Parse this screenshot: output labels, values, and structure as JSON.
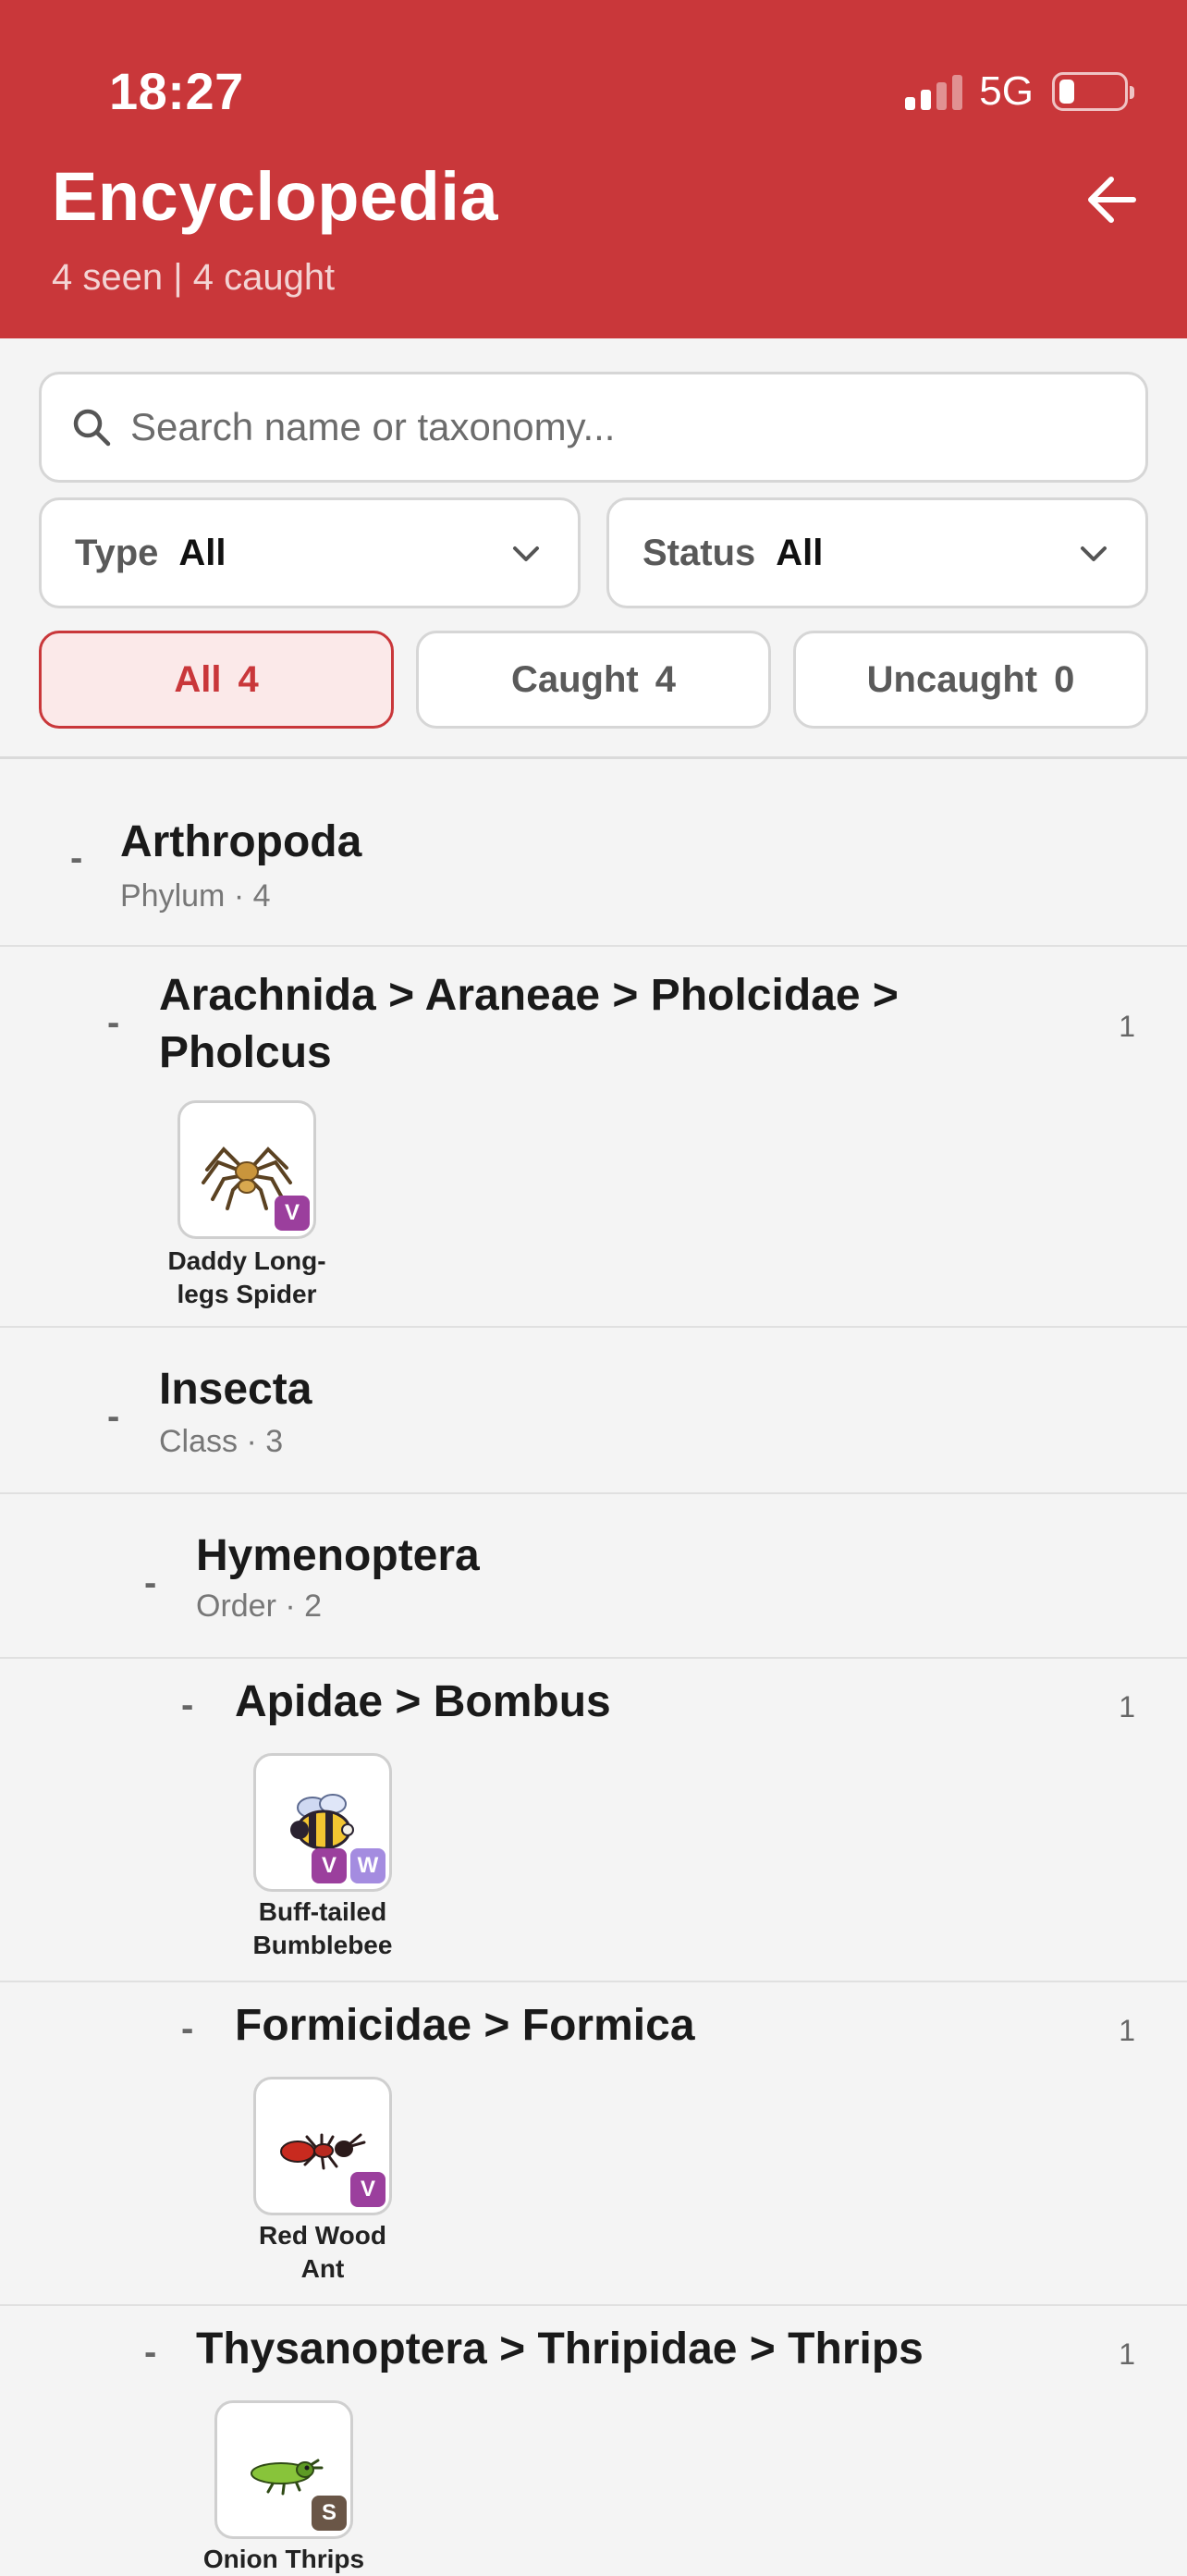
{
  "status_bar": {
    "time": "18:27",
    "network": "5G"
  },
  "header": {
    "title": "Encyclopedia",
    "subtitle": "4 seen | 4 caught"
  },
  "search": {
    "placeholder": "Search name or taxonomy..."
  },
  "filters": {
    "type": {
      "label": "Type",
      "value": "All"
    },
    "status": {
      "label": "Status",
      "value": "All"
    }
  },
  "chips": [
    {
      "label": "All",
      "count": "4"
    },
    {
      "label": "Caught",
      "count": "4"
    },
    {
      "label": "Uncaught",
      "count": "0"
    }
  ],
  "tree": {
    "collapse_symbol": "-",
    "arthropoda": {
      "title": "Arthropoda",
      "sub": "Phylum · 4"
    },
    "pholcus": {
      "title_line1": "Arachnida > Araneae > Pholcidae >",
      "title_line2": "Pholcus",
      "count": "1"
    },
    "insecta": {
      "title": "Insecta",
      "sub": "Class · 3"
    },
    "hymenoptera": {
      "title": "Hymenoptera",
      "sub": "Order · 2"
    },
    "bombus": {
      "title": "Apidae > Bombus",
      "count": "1"
    },
    "formica": {
      "title": "Formicidae > Formica",
      "count": "1"
    },
    "thrips": {
      "title": "Thysanoptera > Thripidae > Thrips",
      "count": "1"
    }
  },
  "species": {
    "spider": {
      "line1": "Daddy Long-",
      "line2": "legs Spider",
      "badges": [
        "V"
      ],
      "icon": "spider-icon"
    },
    "bee": {
      "line1": "Buff-tailed",
      "line2": "Bumblebee",
      "badges": [
        "V",
        "W"
      ],
      "icon": "bumblebee-icon"
    },
    "ant": {
      "line1": "Red Wood",
      "line2": "Ant",
      "badges": [
        "V"
      ],
      "icon": "ant-icon"
    },
    "thrips": {
      "line1": "Onion Thrips",
      "badges": [
        "S"
      ],
      "icon": "thrips-icon"
    }
  },
  "colors": {
    "brand": "#c9373a",
    "badge_v": "#9b3f9d",
    "badge_w": "#a48ce0",
    "badge_s": "#6a5647"
  }
}
